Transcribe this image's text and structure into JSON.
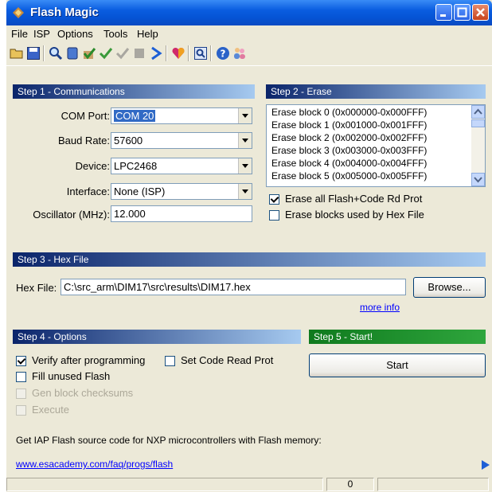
{
  "window": {
    "title": "Flash Magic"
  },
  "menu": {
    "items": [
      "File",
      "ISP",
      "Options",
      "Tools",
      "Help"
    ]
  },
  "toolbar": {
    "icons": [
      "open-icon",
      "save-icon",
      "search-icon",
      "chip-icon",
      "verify-icon",
      "check-icon",
      "blank-check-icon",
      "go-icon",
      "heart-icon",
      "terminal-icon",
      "help-icon",
      "users-icon"
    ]
  },
  "step1": {
    "title": "Step 1 - Communications",
    "com_port_label": "COM Port:",
    "com_port_value": "COM 20",
    "baud_label": "Baud Rate:",
    "baud_value": "57600",
    "device_label": "Device:",
    "device_value": "LPC2468",
    "interface_label": "Interface:",
    "interface_value": "None (ISP)",
    "osc_label": "Oscillator (MHz):",
    "osc_value": "12.000"
  },
  "step2": {
    "title": "Step 2 - Erase",
    "blocks": [
      "Erase block 0 (0x000000-0x000FFF)",
      "Erase block 1 (0x001000-0x001FFF)",
      "Erase block 2 (0x002000-0x002FFF)",
      "Erase block 3 (0x003000-0x003FFF)",
      "Erase block 4 (0x004000-0x004FFF)",
      "Erase block 5 (0x005000-0x005FFF)"
    ],
    "erase_all_label": "Erase all Flash+Code Rd Prot",
    "erase_all_checked": true,
    "erase_hex_label": "Erase blocks used by Hex File",
    "erase_hex_checked": false
  },
  "step3": {
    "title": "Step 3 - Hex File",
    "hex_label": "Hex File:",
    "hex_value": "C:\\src_arm\\DIM17\\src\\results\\DIM17.hex",
    "browse_label": "Browse...",
    "more_info": "more info"
  },
  "step4": {
    "title": "Step 4 - Options",
    "verify_label": "Verify after programming",
    "verify_checked": true,
    "code_read_label": "Set Code Read Prot",
    "fill_label": "Fill unused Flash",
    "gen_label": "Gen block checksums",
    "execute_label": "Execute"
  },
  "step5": {
    "title": "Step 5 - Start!",
    "start_label": "Start"
  },
  "footer": {
    "info_text": "Get IAP Flash source code for NXP microcontrollers with Flash memory:",
    "link_text": "www.esacademy.com/faq/progs/flash"
  },
  "status": {
    "count": "0"
  },
  "colors": {
    "title_blue": "#0553d4",
    "section_blue": "#0a246a",
    "start_green": "#0f7a1e",
    "link_blue": "#0000ff"
  }
}
